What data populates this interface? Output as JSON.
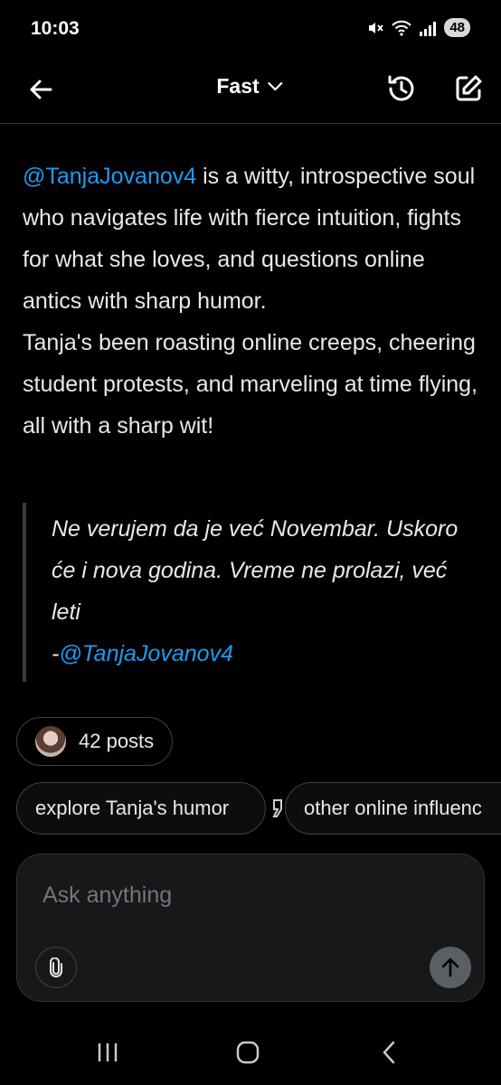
{
  "status_bar": {
    "time": "10:03",
    "battery": "48",
    "icons": [
      "mute-icon",
      "wifi-icon",
      "signal-icon"
    ]
  },
  "header": {
    "title": "Fast",
    "icons": [
      "back-arrow-icon",
      "chevron-down-icon",
      "history-icon",
      "compose-icon"
    ]
  },
  "response": {
    "mention": "@TanjaJovanov4",
    "paragraph1_rest": " is a witty, introspective soul who navigates life with fierce intuition, fights for what she loves, and questions online antics with sharp humor.",
    "paragraph2": "Tanja's been roasting online creeps, cheering student protests, and marveling at time flying, all with a sharp wit!"
  },
  "quote": {
    "text": "Ne verujem da je već Novembar. Uskoro će i nova godina. Vreme ne prolazi, već leti",
    "attribution_prefix": "-",
    "attribution_mention": "@TanjaJovanov4"
  },
  "posts_chip": {
    "label": "42 posts"
  },
  "suggestions": [
    "explore Tanja's humor",
    "other online influenc"
  ],
  "composer": {
    "placeholder": "Ask anything"
  },
  "colors": {
    "background": "#000000",
    "text": "#e7e9ea",
    "accent": "#1d9bf0",
    "border": "#3e4144"
  }
}
